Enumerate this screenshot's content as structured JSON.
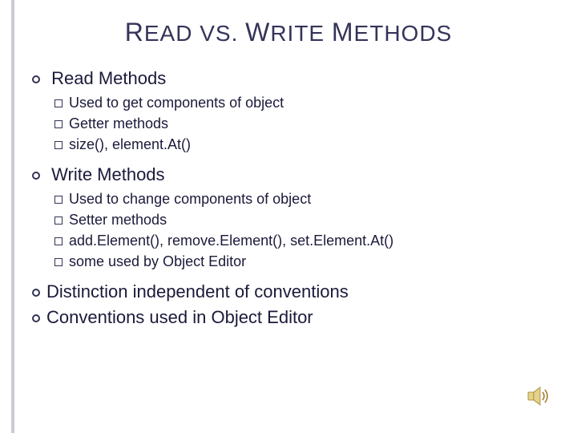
{
  "title_parts": [
    "R",
    "EAD VS. ",
    "W",
    "RITE ",
    "M",
    "ETHODS"
  ],
  "bullets": [
    {
      "text": "Read Methods",
      "children": [
        "Used to get components of object",
        "Getter methods",
        "size(), element.At()"
      ]
    },
    {
      "text": "Write Methods",
      "children": [
        "Used to change components of object",
        "Setter methods",
        "add.Element(), remove.Element(), set.Element.At()",
        "some used by Object Editor"
      ]
    },
    {
      "text": "Distinction independent of conventions",
      "children": []
    },
    {
      "text": "Conventions used in Object Editor",
      "children": []
    }
  ],
  "icon_name": "speaker-icon"
}
